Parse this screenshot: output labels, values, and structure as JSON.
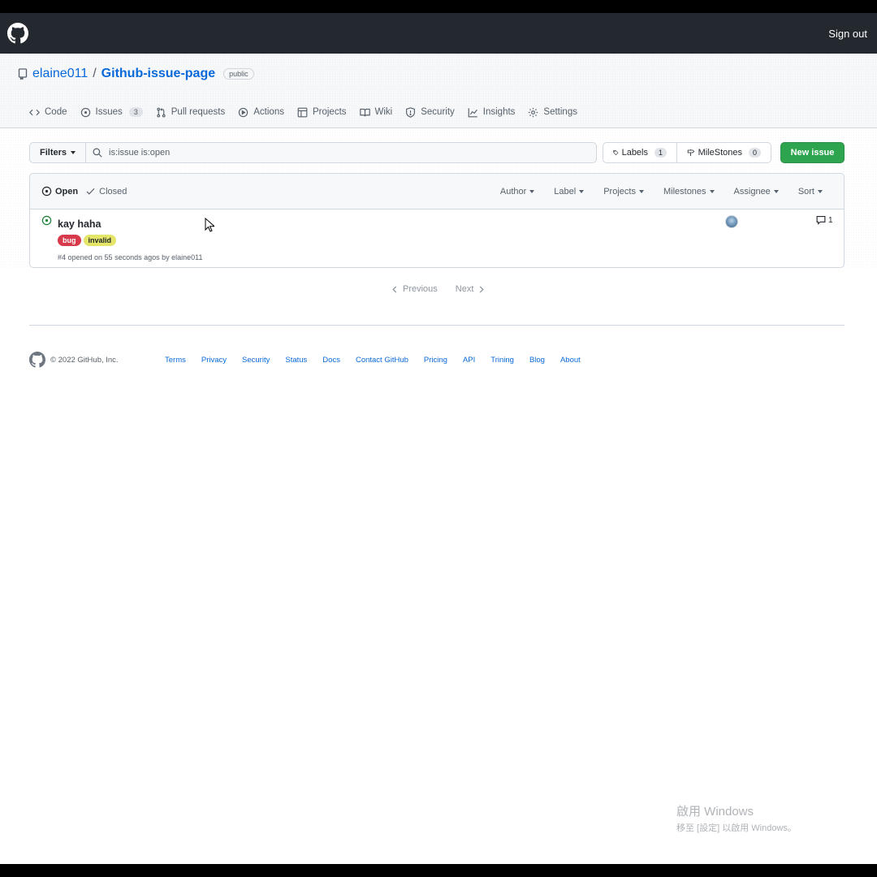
{
  "header": {
    "sign_out_label": "Sign out"
  },
  "repo": {
    "owner": "elaine011",
    "separator": "/",
    "name": "Github-issue-page",
    "visibility": "public"
  },
  "tabs": [
    {
      "label": "Code",
      "icon": "code-icon"
    },
    {
      "label": "Issues",
      "icon": "issue-opened-icon",
      "count": "3"
    },
    {
      "label": "Pull requests",
      "icon": "git-pull-request-icon"
    },
    {
      "label": "Actions",
      "icon": "play-icon"
    },
    {
      "label": "Projects",
      "icon": "table-icon"
    },
    {
      "label": "Wiki",
      "icon": "book-icon"
    },
    {
      "label": "Security",
      "icon": "shield-icon"
    },
    {
      "label": "Insights",
      "icon": "graph-icon"
    },
    {
      "label": "Settings",
      "icon": "gear-icon"
    }
  ],
  "toolbar": {
    "filters_label": "Filters",
    "search_value": "is:issue is:open",
    "labels_label": "Labels",
    "labels_count": "1",
    "milestones_label": "MileStones",
    "milestones_count": "0",
    "new_issue_label": "New issue",
    "new_issue_color": "#2da44e"
  },
  "issues_header": {
    "open_label": "Open",
    "closed_label": "Closed",
    "filters": [
      "Author",
      "Label",
      "Projects",
      "Milestones",
      "Assignee",
      "Sort"
    ]
  },
  "issues": [
    {
      "title": "kay haha",
      "labels": [
        {
          "name": "bug",
          "bg": "#d73a4a",
          "fg": "#ffffff"
        },
        {
          "name": "invalid",
          "bg": "#e4e669",
          "fg": "#1f2328"
        }
      ],
      "meta": "#4 opened on 55 seconds agos by elaine011",
      "comments": "1"
    }
  ],
  "pagination": {
    "previous": "Previous",
    "next": "Next"
  },
  "footer": {
    "copyright": "© 2022 GitHub, Inc.",
    "links": [
      "Terms",
      "Privacy",
      "Security",
      "Status",
      "Docs",
      "Contact GitHub",
      "Pricing",
      "API",
      "Trining",
      "Blog",
      "About"
    ]
  },
  "watermark": {
    "line1": "啟用 Windows",
    "line2": "移至 [設定] 以啟用 Windows。"
  }
}
